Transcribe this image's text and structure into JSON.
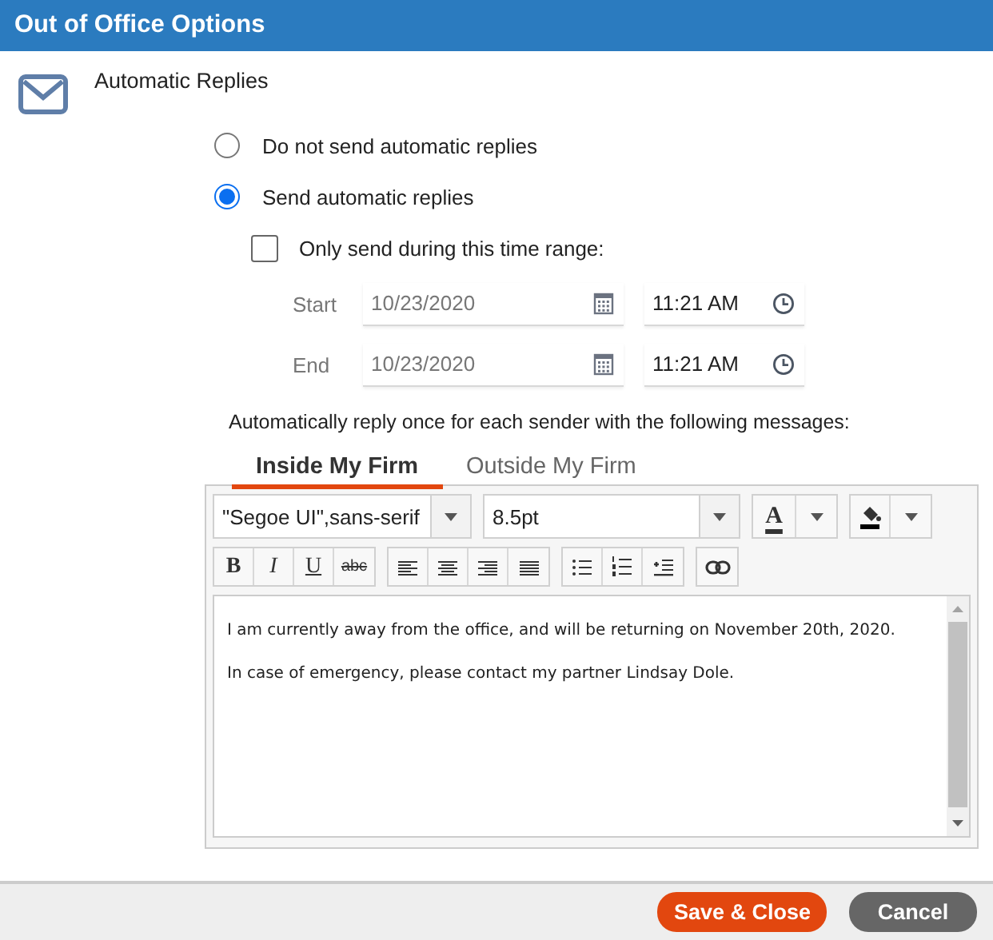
{
  "window": {
    "title": "Out of Office Options"
  },
  "section": {
    "title": "Automatic Replies"
  },
  "reply_mode": [
    {
      "label": "Do not send automatic replies",
      "selected": false
    },
    {
      "label": "Send automatic replies",
      "selected": true
    }
  ],
  "time_range": {
    "label": "Only send during this time range:",
    "checked": false,
    "rows": [
      {
        "label": "Start",
        "date": "10/23/2020",
        "time": "11:21 AM"
      },
      {
        "label": "End",
        "date": "10/23/2020",
        "time": "11:21 AM"
      }
    ]
  },
  "message_intro": "Automatically reply once for each sender with the following messages:",
  "tabs": [
    {
      "label": "Inside My Firm",
      "selected": true
    },
    {
      "label": "Outside My Firm",
      "selected": false
    }
  ],
  "editor": {
    "font": "\"Segoe UI\",sans-serif",
    "size": "8.5pt",
    "text_color_label": "A",
    "format_buttons": [
      {
        "kind": "bold",
        "label": "B"
      },
      {
        "kind": "italic",
        "label": "I"
      },
      {
        "kind": "underline",
        "label": "U"
      },
      {
        "kind": "strike",
        "label": "abc"
      }
    ],
    "paragraphs": [
      "I am currently away from the office, and will be returning on November 20th, 2020.",
      "In case of emergency, please contact my partner Lindsay Dole."
    ]
  },
  "buttons": [
    {
      "label": "Save & Close",
      "kind": "primary"
    },
    {
      "label": "Cancel",
      "kind": "secondary"
    }
  ]
}
